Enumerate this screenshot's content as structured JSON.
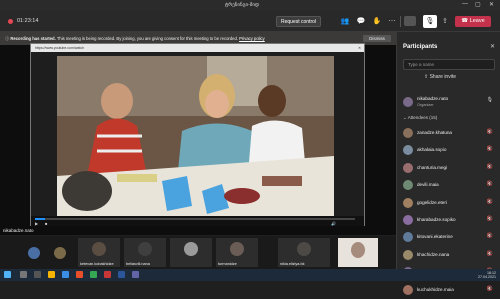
{
  "window": {
    "title": "ტრენინგი-მიდ"
  },
  "meeting": {
    "timer": "01:23:14",
    "request_control": "Request control",
    "leave_label": "Leave"
  },
  "banner": {
    "bold": "Recording has started.",
    "text": "This meeting is being recorded. By joining, you are giving consent for this meeting to be recorded.",
    "link": "Privacy policy",
    "dismiss": "Dismiss"
  },
  "player": {
    "title": "https://www.youtube.com/watch"
  },
  "stage": {
    "speaker_name": "nikabadze.nato"
  },
  "video_tiles": [
    {
      "name": "",
      "color": "#4a6fa5"
    },
    {
      "name": "",
      "color": "#7b6a48"
    },
    {
      "name": "ketevan.kobakhidze",
      "color": "#5a4d42"
    },
    {
      "name": "beliasvili.nana",
      "color": "#3f3f3f"
    },
    {
      "name": "turmanidze",
      "color": "#6a5d55"
    },
    {
      "name": "nikia.eliziya.bk",
      "color": "#4d4a45"
    },
    {
      "name": "",
      "color": "#a58b7c"
    }
  ],
  "panel": {
    "title": "Participants",
    "search_placeholder": "Type a name",
    "share_invite": "Share invite",
    "organizer": {
      "name": "nikabadze.nato",
      "role": "Organizer"
    },
    "attendees_label": "Attendees (15)",
    "attendees": [
      {
        "name": "zanadze.khatuna",
        "color": "#8a6f5a"
      },
      {
        "name": "akhalaia.sopio",
        "color": "#7a8da0"
      },
      {
        "name": "chanturia.megi",
        "color": "#9a6e6e"
      },
      {
        "name": "devili.maia",
        "color": "#6f8a74"
      },
      {
        "name": "gogelidze.eteri",
        "color": "#a08060"
      },
      {
        "name": "kharabadze.sopiko",
        "color": "#8a6da0"
      },
      {
        "name": "kitovani.ekaterine",
        "color": "#607a9a"
      },
      {
        "name": "khachidze.nana",
        "color": "#9a8a6a"
      },
      {
        "name": "kopaliani.irina",
        "color": "#7a6a8a"
      },
      {
        "name": "kuchukhidze.maia",
        "color": "#a07060"
      }
    ]
  },
  "taskbar": {
    "time": "18:12",
    "date": "27.04.2021",
    "lang": "ENG"
  },
  "colors": {
    "leave": "#c4314b",
    "recording_dot": "#e74856",
    "accent": "#6264a7"
  }
}
